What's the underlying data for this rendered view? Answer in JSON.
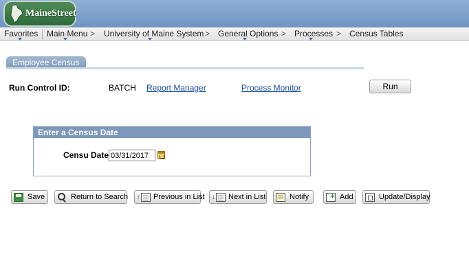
{
  "brand": {
    "name": "MaineStreet"
  },
  "nav": {
    "items": [
      "Favorites",
      "Main Menu",
      "University of Maine System",
      "General Options",
      "Processes",
      "Census Tables"
    ],
    "separator": ">"
  },
  "page": {
    "tab_label": "Employee Census"
  },
  "run_control": {
    "label": "Run Control ID:",
    "value": "BATCH",
    "report_manager": "Report Manager",
    "process_monitor": "Process Monitor",
    "run_label": "Run"
  },
  "census_group": {
    "title": "Enter a Census Date",
    "field_label": "Censu Date",
    "field_value": "03/31/2017"
  },
  "toolbar": {
    "save": "Save",
    "return_to_search": "Return to Search",
    "previous_in_list": "Previous in List",
    "next_in_list": "Next in List",
    "notify": "Notify",
    "add": "Add",
    "update_display": "Update/Display"
  },
  "icons": {
    "logo": "maine-state-icon",
    "calendar": "calendar-icon",
    "save": "save-icon",
    "return_to_search": "search-icon",
    "previous": "previous-icon",
    "next": "next-icon",
    "notify": "notify-icon",
    "add": "add-icon",
    "update": "update-icon"
  },
  "colors": {
    "banner": "#6f94c3",
    "logo": "#2e6a3a",
    "tab": "#7f9bbb",
    "link": "#1b4f9c",
    "group_header": "#7d98ba"
  }
}
